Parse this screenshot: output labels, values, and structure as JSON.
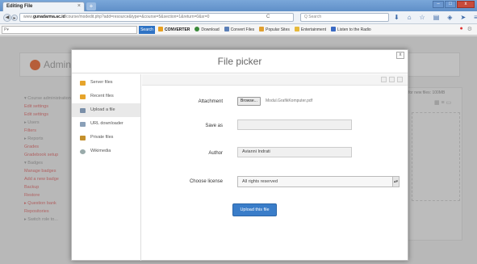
{
  "browser": {
    "tab_title": "Editing File",
    "tab_close": "×",
    "new_tab": "+",
    "url_prefix": "www.",
    "url_domain": "gunadarma.ac.id",
    "url_rest": "/course/modedit.php?add=resource&type=&course=5&section=1&return=0&sr=0",
    "reload_icon": "C",
    "search_placeholder": "Q Search",
    "window_controls": {
      "minimize": "–",
      "maximize": "□",
      "close": "x"
    }
  },
  "toolbar": {
    "search_field": "P▾",
    "search_button": "Search",
    "items": [
      "CONVERTER",
      "Download",
      "Convert Files",
      "Popular Sites",
      "Entertainment",
      "Listen to the Radio"
    ]
  },
  "page": {
    "admin_title": "Administ",
    "left_nav": [
      "▾ Course administration",
      "Edit settings",
      "Edit settings",
      "▸ Users",
      "Filters",
      "▸ Reports",
      "Grades",
      "Gradebook setup",
      "▾ Badges",
      "Manage badges",
      "Add a new badge",
      "Backup",
      "Restore",
      "▸ Question bank",
      "Repositories",
      "▸ Switch role to..."
    ],
    "right_panel_text": "for new files: 100MB"
  },
  "dialog": {
    "title": "File picker",
    "close": "x",
    "repositories": [
      {
        "label": "Server files",
        "icon": "folder-icon"
      },
      {
        "label": "Recent files",
        "icon": "folder-icon"
      },
      {
        "label": "Upload a file",
        "icon": "upload-icon",
        "active": true
      },
      {
        "label": "URL downloader",
        "icon": "link-icon"
      },
      {
        "label": "Private files",
        "icon": "folder-icon"
      },
      {
        "label": "Wikimedia",
        "icon": "wikimedia-icon"
      }
    ],
    "form": {
      "attachment_label": "Attachment",
      "browse_button": "Browse...",
      "file_name": "Modul.GrafikKomputer.pdf",
      "save_as_label": "Save as",
      "save_as_value": "",
      "author_label": "Author",
      "author_value": "Avianni Indrati",
      "license_label": "Choose license",
      "license_value": "All rights reserved",
      "upload_button": "Upload this file"
    }
  },
  "colors": {
    "accent": "#3a7dc9",
    "logo": "#e8622a"
  }
}
